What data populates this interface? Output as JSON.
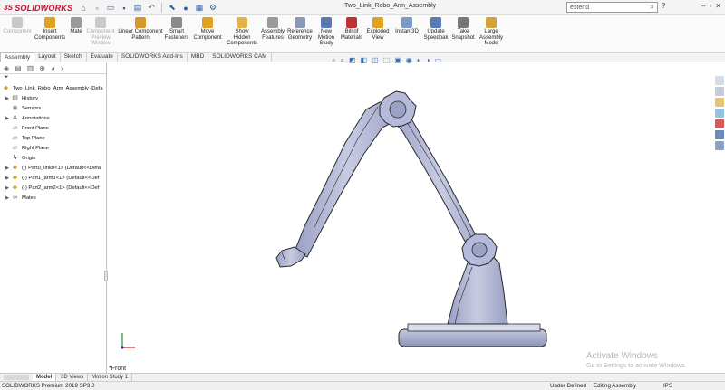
{
  "app": {
    "brand": "SOLIDWORKS",
    "window_title": "Two_Link_Robo_Arm_Assembly",
    "search_value": "extend",
    "help_label": "?",
    "minimize_label": "–",
    "close_label": "✕"
  },
  "ribbon": [
    {
      "label": "Component",
      "disabled": true,
      "color": "#c9c9c9"
    },
    {
      "label": "Insert\nComponents",
      "color": "#e0a020"
    },
    {
      "label": "Mate",
      "color": "#9a9a9a"
    },
    {
      "label": "Component\nPreview\nWindow",
      "disabled": true,
      "color": "#c9c9c9"
    },
    {
      "label": "Linear Component\nPattern",
      "color": "#d79a2a"
    },
    {
      "label": "Smart\nFasteners",
      "color": "#8a8a8a"
    },
    {
      "label": "Move\nComponent",
      "color": "#e0a020"
    },
    {
      "label": "Show\nHidden\nComponents",
      "color": "#e4b44a"
    },
    {
      "label": "Assembly\nFeatures",
      "color": "#9a9a9a"
    },
    {
      "label": "Reference\nGeometry",
      "color": "#8a9ab4"
    },
    {
      "label": "New\nMotion\nStudy",
      "color": "#5a7ab4"
    },
    {
      "label": "Bill of\nMaterials",
      "color": "#c03030"
    },
    {
      "label": "Exploded\nView",
      "color": "#e0a020"
    },
    {
      "label": "Instant3D",
      "color": "#7a9ac8"
    },
    {
      "label": "Update\nSpeedpak",
      "color": "#5a7ab4"
    },
    {
      "label": "Take\nSnapshot",
      "color": "#777777"
    },
    {
      "label": "Large\nAssembly\nMode",
      "color": "#d4a23a"
    }
  ],
  "tabs": [
    "Assembly",
    "Layout",
    "Sketch",
    "Evaluate",
    "SOLIDWORKS Add-Ins",
    "MBD",
    "SOLIDWORKS CAM"
  ],
  "active_tab": "Assembly",
  "tree": {
    "root": "Two_Link_Robo_Arm_Assembly  (Defa",
    "items": [
      {
        "label": "History",
        "icon": "history-icon",
        "expandable": true
      },
      {
        "label": "Sensors",
        "icon": "sensor-icon",
        "expandable": false
      },
      {
        "label": "Annotations",
        "icon": "annotation-icon",
        "expandable": true
      },
      {
        "label": "Front Plane",
        "icon": "plane-icon",
        "expandable": false
      },
      {
        "label": "Top Plane",
        "icon": "plane-icon",
        "expandable": false
      },
      {
        "label": "Right Plane",
        "icon": "plane-icon",
        "expandable": false
      },
      {
        "label": "Origin",
        "icon": "origin-icon",
        "expandable": false
      },
      {
        "label": "(f) Part0_link0<1> (Default<<Defa",
        "icon": "part-icon",
        "expandable": true
      },
      {
        "label": "(-) Part1_arm1<1> (Default<<Def",
        "icon": "part-icon",
        "expandable": true
      },
      {
        "label": "(-) Part2_arm2<1> (Default<<Def",
        "icon": "part-icon",
        "expandable": true
      },
      {
        "label": "Mates",
        "icon": "mates-icon",
        "expandable": true
      }
    ]
  },
  "bottom_tabs": [
    "Model",
    "3D Views",
    "Motion Study 1"
  ],
  "active_bottom_tab": "Model",
  "view_label": "*Front",
  "status": {
    "product": "SOLIDWORKS Premium 2019 SP3.0",
    "definition": "Under Defined",
    "mode": "Editing Assembly",
    "units": "IPS"
  },
  "watermark": {
    "line1": "Activate Windows",
    "line2": "Go to Settings to activate Windows."
  },
  "colors": {
    "brand": "#c8102e",
    "part_fill": "#b8bdd8",
    "part_shade": "#8f95b8",
    "part_edge": "#2a2a2a"
  }
}
